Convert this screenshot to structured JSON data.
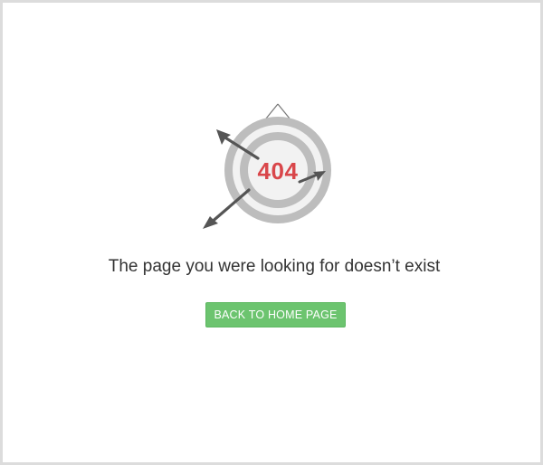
{
  "error": {
    "code_label": "404",
    "message": "The page you were looking for doesn’t exist",
    "home_button_label": "BACK TO HOME PAGE"
  },
  "icons": {
    "illustration": "dartboard-with-arrows-icon"
  },
  "colors": {
    "error_code": "#d9464a",
    "button_background": "#6cc46f",
    "target_ring": "#bdbdbd",
    "arrow": "#555555",
    "frame_border": "#dcdcdc"
  }
}
